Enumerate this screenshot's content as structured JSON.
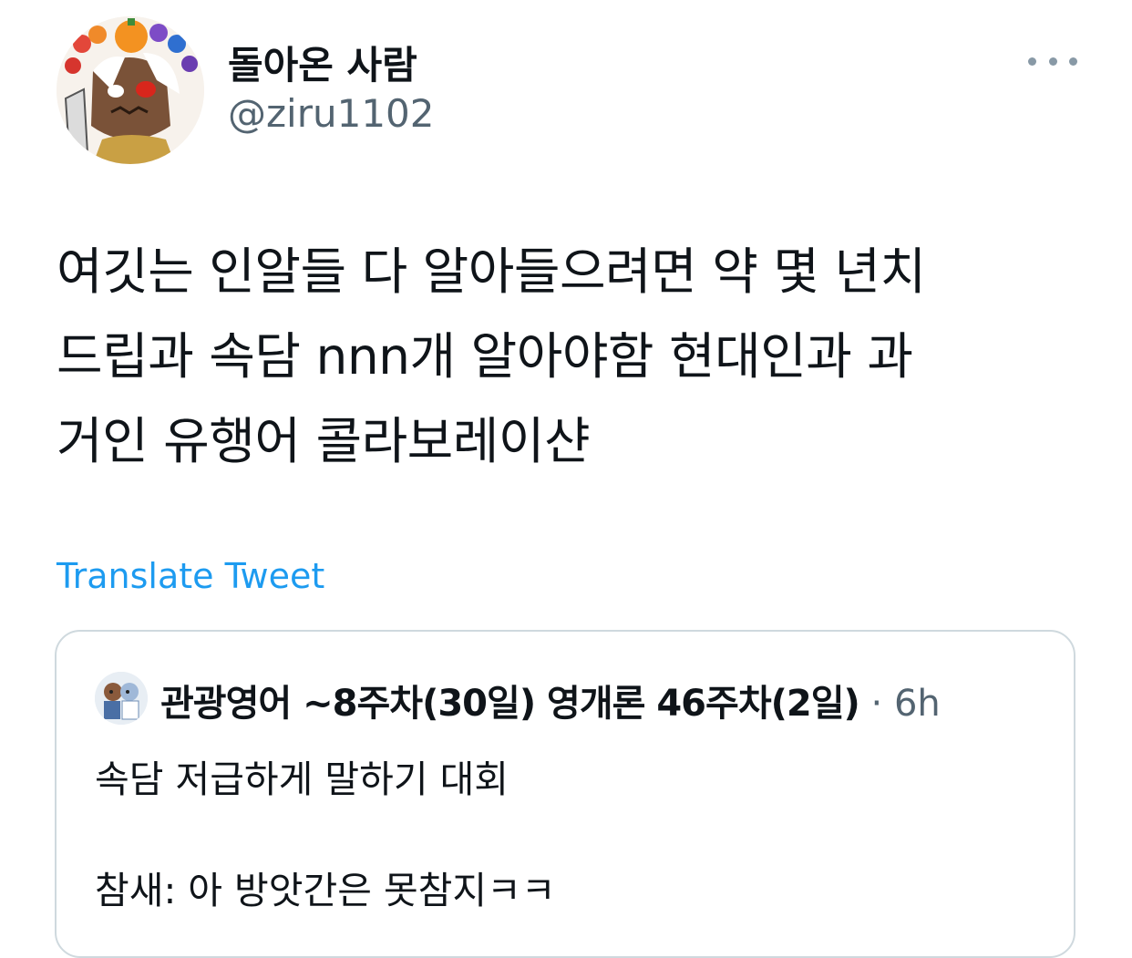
{
  "author": {
    "display_name": "돌아온 사람",
    "handle": "@ziru1102",
    "avatar_icon": "profile-avatar-icon"
  },
  "more_icon": "more-horizontal-icon",
  "tweet": {
    "lines": [
      "여깃는 인알들 다 알아들으려면 약 몇 년치",
      "드립과 속담 nnn개 알아야함 현대인과 과",
      "거인 유행어 콜라보레이샨"
    ]
  },
  "translate_label": "Translate Tweet",
  "quoted_tweet": {
    "author_name": "관광영어 ~8주차(30일) 영개론 46주차(2일)",
    "separator": "·",
    "time": "6h",
    "line1": "속담 저급하게 말하기 대회",
    "line2": "참새: 아 방앗간은 못참지ㅋㅋ"
  },
  "colors": {
    "text": "#0f1419",
    "secondary": "#536471",
    "link": "#1d9bf0",
    "border": "#cfd9de"
  }
}
